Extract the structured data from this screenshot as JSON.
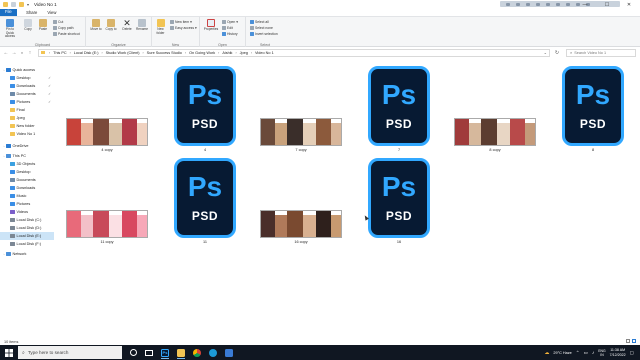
{
  "window": {
    "title": "Video No 1",
    "controls": [
      "—",
      "☐",
      "✕"
    ]
  },
  "ribbon_tabs": [
    "File",
    "Home",
    "Share",
    "View"
  ],
  "ribbon": {
    "clipboard": {
      "label": "Clipboard",
      "pin": "Pin to Quick access",
      "copy": "Copy",
      "paste": "Paste",
      "cut": "Cut",
      "copy_path": "Copy path",
      "paste_shortcut": "Paste shortcut"
    },
    "organize": {
      "label": "Organize",
      "move_to": "Move to",
      "copy_to": "Copy to",
      "delete": "Delete",
      "rename": "Rename"
    },
    "new": {
      "label": "New",
      "new_folder": "New folder",
      "new_item": "New item ▾",
      "easy_access": "Easy access ▾"
    },
    "open": {
      "label": "Open",
      "properties": "Properties",
      "open": "Open ▾",
      "edit": "Edit",
      "history": "History"
    },
    "select": {
      "label": "Select",
      "select_all": "Select all",
      "select_none": "Select none",
      "invert": "Invert selection"
    }
  },
  "address": {
    "crumbs": [
      "This PC",
      "Local Disk (E:)",
      "Studio Work (Client)",
      "Sure Success Studio",
      "On Going Work",
      "Aishik",
      "Jpeg",
      "Video No 1"
    ],
    "search_placeholder": "Search Video No 1"
  },
  "sidebar": {
    "items": [
      {
        "label": "Quick access",
        "icon": "star-icon",
        "color": "#2b7cd3"
      },
      {
        "label": "Desktop",
        "icon": "desktop-icon",
        "color": "#3a8ee6",
        "pinned": "✓"
      },
      {
        "label": "Downloads",
        "icon": "download-icon",
        "color": "#3a8ee6",
        "pinned": "✓"
      },
      {
        "label": "Documents",
        "icon": "documents-icon",
        "color": "#6e8aa8",
        "pinned": "✓"
      },
      {
        "label": "Pictures",
        "icon": "pictures-icon",
        "color": "#3a8ee6",
        "pinned": "✓"
      },
      {
        "label": "Final",
        "icon": "folder-icon",
        "color": "#f2c453"
      },
      {
        "label": "Jpeg",
        "icon": "folder-icon",
        "color": "#f2c453"
      },
      {
        "label": "New folder",
        "icon": "folder-icon",
        "color": "#f2c453"
      },
      {
        "label": "Video No 1",
        "icon": "folder-icon",
        "color": "#f2c453"
      },
      {
        "label": "OneDrive",
        "icon": "cloud-icon",
        "color": "#2b7cd3"
      },
      {
        "label": "This PC",
        "icon": "computer-icon",
        "color": "#4a90d9"
      },
      {
        "label": "3D Objects",
        "icon": "cube-icon",
        "color": "#3aa0e0"
      },
      {
        "label": "Desktop",
        "icon": "desktop-icon",
        "color": "#3a8ee6"
      },
      {
        "label": "Documents",
        "icon": "documents-icon",
        "color": "#6e8aa8"
      },
      {
        "label": "Downloads",
        "icon": "download-icon",
        "color": "#3a8ee6"
      },
      {
        "label": "Music",
        "icon": "music-icon",
        "color": "#3a8ee6"
      },
      {
        "label": "Pictures",
        "icon": "pictures-icon",
        "color": "#3a8ee6"
      },
      {
        "label": "Videos",
        "icon": "videos-icon",
        "color": "#7a5ec9"
      },
      {
        "label": "Local Disk (C:)",
        "icon": "drive-icon",
        "color": "#7b8794"
      },
      {
        "label": "Local Disk (D:)",
        "icon": "drive-icon",
        "color": "#7b8794"
      },
      {
        "label": "Local Disk (E:)",
        "icon": "drive-icon",
        "color": "#7b8794",
        "selected": true
      },
      {
        "label": "Local Disk (F:)",
        "icon": "drive-icon",
        "color": "#7b8794"
      },
      {
        "label": "Network",
        "icon": "network-icon",
        "color": "#4a90d9"
      }
    ]
  },
  "files": [
    {
      "name": "4 copy",
      "type": "jpeg"
    },
    {
      "name": "4",
      "type": "psd"
    },
    {
      "name": "7 copy",
      "type": "jpeg"
    },
    {
      "name": "7",
      "type": "psd"
    },
    {
      "name": "8 copy",
      "type": "jpeg"
    },
    {
      "name": "8",
      "type": "psd"
    },
    {
      "name": "11 copy",
      "type": "jpeg"
    },
    {
      "name": "11",
      "type": "psd"
    },
    {
      "name": "16 copy",
      "type": "jpeg"
    },
    {
      "name": "16",
      "type": "psd"
    }
  ],
  "psd_icon": {
    "top": "Ps",
    "bottom": "PSD",
    "accent": "#31a8ff",
    "bg": "#071a33"
  },
  "status": {
    "count": "10 items"
  },
  "taskbar": {
    "search_placeholder": "Type here to search",
    "apps": [
      "cortana-icon",
      "task-view-icon",
      "photoshop-icon",
      "file-explorer-icon",
      "chrome-icon",
      "edge-icon",
      "photos-icon"
    ],
    "weather": "29°C  Haze",
    "lang": "ENG",
    "lang_region": "IN",
    "time": "11:38 AM",
    "date": "7/12/2022"
  }
}
